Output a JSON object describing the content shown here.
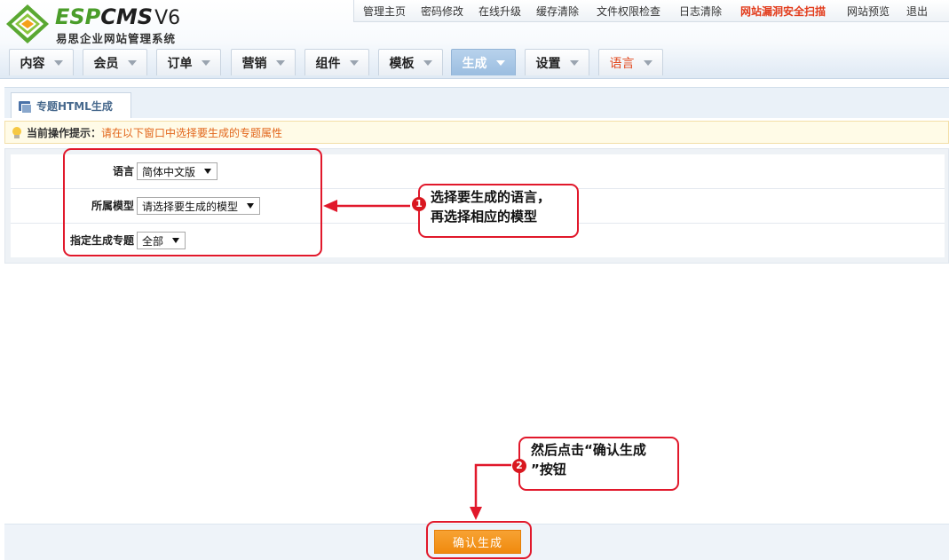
{
  "brand": {
    "logo_esp": "ESP",
    "logo_cms": "CMS",
    "logo_version": "V6",
    "subtitle": "易思企业网站管理系统",
    "colors": {
      "green": "#4a9d2a",
      "dark": "#1f1f1f"
    }
  },
  "top_links": [
    "管理主页",
    "密码修改",
    "在线升级",
    "缓存清除",
    "文件权限检查",
    "日志清除",
    "网站漏洞安全扫描",
    "网站预览",
    "退出"
  ],
  "main_menu": [
    {
      "label": "内容"
    },
    {
      "label": "会员"
    },
    {
      "label": "订单"
    },
    {
      "label": "营销"
    },
    {
      "label": "组件"
    },
    {
      "label": "模板"
    },
    {
      "label": "生成",
      "active": true
    },
    {
      "label": "设置"
    },
    {
      "label": "语言",
      "accent": "#e2491f"
    }
  ],
  "sub_tab": "专题HTML生成",
  "tip": {
    "label": "当前操作提示：",
    "text": "请在以下窗口中选择要生成的专题属性"
  },
  "form": {
    "language": {
      "label": "语言",
      "value": "简体中文版"
    },
    "model": {
      "label": "所属模型",
      "value": "请选择要生成的模型"
    },
    "topic": {
      "label": "指定生成专题",
      "value": "全部"
    }
  },
  "confirm_button": "确认生成",
  "annotations": {
    "step1": {
      "number": "1",
      "line1": "选择要生成的语言，",
      "line2": "再选择相应的模型"
    },
    "step2": {
      "number": "2",
      "line1": "然后点击“确认生成",
      "line2": "”按钮"
    },
    "color": "#e1182b"
  }
}
